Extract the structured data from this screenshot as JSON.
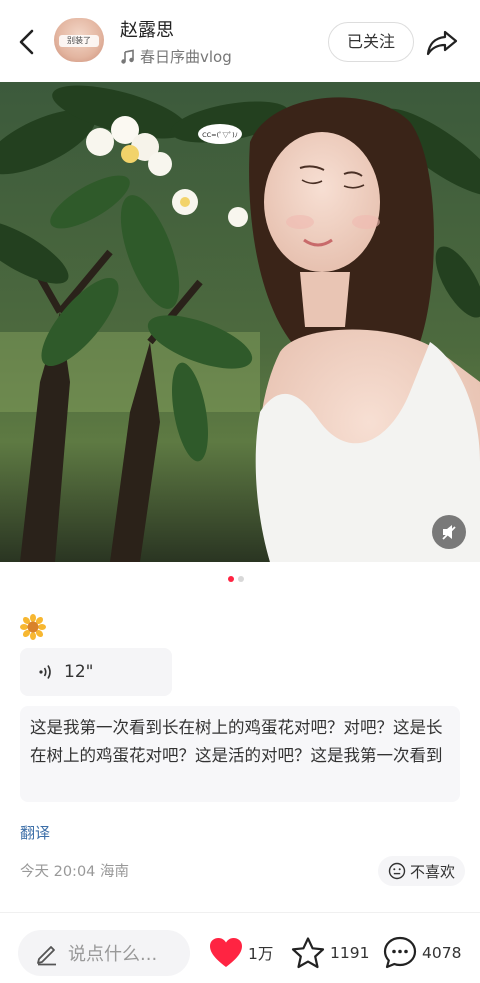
{
  "header": {
    "author_name": "赵露思",
    "music_title": "春日序曲vlog",
    "follow_label": "已关注",
    "avatar_tag": "别装了"
  },
  "photo": {
    "speech_bubble": "CC=(ﾟ▽ﾟ)ﾉ",
    "carousel_total": 2,
    "carousel_active": 1
  },
  "post": {
    "emoji_name": "sunflower-emoji",
    "voice_duration": "12\"",
    "text": "这是我第一次看到长在树上的鸡蛋花对吧？对吧？这是长在树上的鸡蛋花对吧？这是活的对吧？这是我第一次看到",
    "translate_label": "翻译",
    "meta": "今天 20:04 海南",
    "dislike_label": "不喜欢"
  },
  "bottom_bar": {
    "comment_placeholder": "说点什么...",
    "likes": "1万",
    "collects": "1191",
    "comments": "4078"
  },
  "colors": {
    "accent": "#ff2442",
    "link": "#3d6fa8"
  }
}
